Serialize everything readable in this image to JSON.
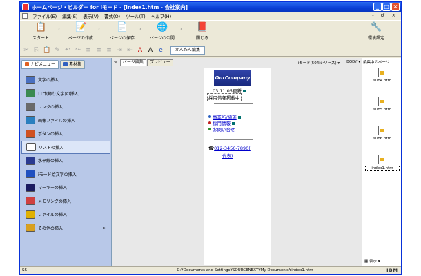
{
  "window": {
    "title": "ホームページ・ビルダー for iモード - [index1.htm - 会社案内]"
  },
  "menubar": {
    "items": [
      "ファイル(E)",
      "編集(E)",
      "表示(V)",
      "書式(O)",
      "ツール(T)",
      "ヘルプ(H)"
    ],
    "mdi_controls": "- ♂ ×"
  },
  "bigbar": {
    "start": "スタート",
    "edit_page": "ページの作成",
    "save_page": "ページの保存",
    "publish_page": "ページの公開",
    "close": "閉じる",
    "env_settings": "環境設定"
  },
  "smallbar": {
    "easy_edit": "かんたん編集"
  },
  "left_panel": {
    "tabs": [
      "ナビメニュー",
      "素材集"
    ],
    "items": [
      {
        "label": "文字の挿入",
        "color": "#4a70c0"
      },
      {
        "label": "ロゴ(飾り文字)の挿入",
        "color": "#3a8a50"
      },
      {
        "label": "リンクの挿入",
        "color": "#6a6a6a"
      },
      {
        "label": "画像ファイルの挿入",
        "color": "#2a80c0"
      },
      {
        "label": "ボタンの挿入",
        "color": "#d05020"
      },
      {
        "label": "リストの挿入",
        "color": "#ffffff"
      },
      {
        "label": "水平線の挿入",
        "color": "#2a3a90"
      },
      {
        "label": "iモード絵文字の挿入",
        "color": "#2050c0"
      },
      {
        "label": "マーキーの挿入",
        "color": "#1a1a60"
      },
      {
        "label": "メモリンクの挿入",
        "color": "#d04040"
      },
      {
        "label": "ファイルの挿入",
        "color": "#e0b000"
      },
      {
        "label": "その他の挿入",
        "color": "#d8a020"
      }
    ],
    "selected_index": 5,
    "submenu_mark": "►"
  },
  "editor": {
    "tabs": [
      "ページ編集",
      "プレビュー"
    ],
    "mode_select": "iモード(504iシリーズ)",
    "tag_select": "BODY",
    "page": {
      "logo": "OurCompany",
      "updated": "03.11.05更新",
      "recruiting": "採用情報掲載中",
      "links": [
        {
          "label": "事業所/協施",
          "color": "#2a60c0"
        },
        {
          "label": "採用情報",
          "color": "#c02020"
        },
        {
          "label": "お問い合せ",
          "color": "#2a8a2a"
        }
      ],
      "phone": "012-3456-7890(",
      "phone2": "代表)"
    }
  },
  "right_panel": {
    "title": "編集中のページ",
    "files": [
      "sub4.htm",
      "sub5.htm",
      "sub6.htm",
      "index1.htm"
    ],
    "selected_index": 3,
    "view_label": "表示"
  },
  "statusbar": {
    "left": "SS",
    "path": "C:¥Documents and Settings¥SOURCENEXT¥My Documents¥index1.htm",
    "brand": "IBM"
  }
}
